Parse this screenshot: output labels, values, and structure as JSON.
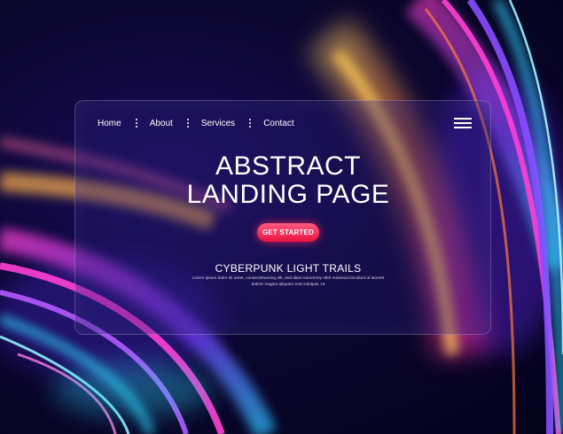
{
  "nav": {
    "items": [
      {
        "label": "Home"
      },
      {
        "label": "About"
      },
      {
        "label": "Services"
      },
      {
        "label": "Contact"
      }
    ]
  },
  "hero": {
    "title_line1": "ABSTRACT",
    "title_line2": "LANDING PAGE",
    "cta_label": "GET STARTED",
    "subtitle": "CYBERPUNK LIGHT TRAILS",
    "body": "Lorem ipsum dolor sit amet, consectetuering elit, sed diam nonummy nibh euismod tincidunt ut laoreet dolore magna aliquam erat volutpat. Ut"
  },
  "icons": {
    "menu": "hamburger-menu-icon"
  },
  "colors": {
    "background": "#05031a",
    "cta": "#e8123f",
    "trail_magenta": "#ff2fd6",
    "trail_cyan": "#2fd6ff",
    "trail_orange": "#ffa640",
    "trail_violet": "#7a3cff"
  }
}
